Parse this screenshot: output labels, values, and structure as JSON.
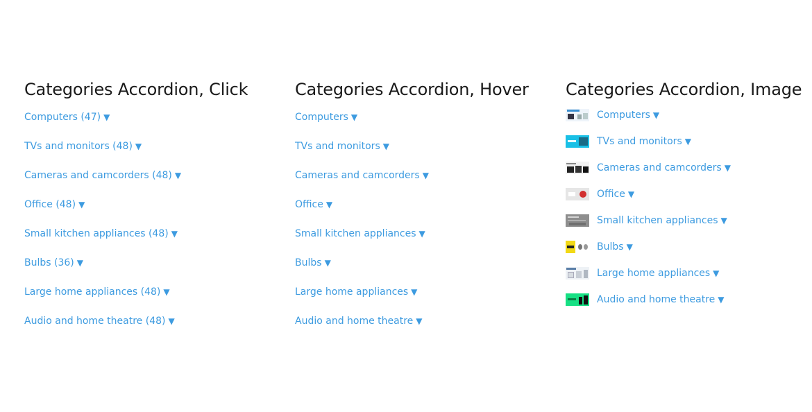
{
  "arrow_glyph": "▼",
  "accent_color": "#3d9be0",
  "click_accordion": {
    "title": "Categories Accordion, Click",
    "items": [
      {
        "label": "Computers (47)"
      },
      {
        "label": "TVs and monitors (48)"
      },
      {
        "label": "Cameras and camcorders (48)"
      },
      {
        "label": "Office (48)"
      },
      {
        "label": "Small kitchen appliances (48)"
      },
      {
        "label": "Bulbs (36)"
      },
      {
        "label": "Large home appliances (48)"
      },
      {
        "label": "Audio and home theatre (48)"
      }
    ]
  },
  "hover_accordion": {
    "title": "Categories Accordion, Hover",
    "items": [
      {
        "label": "Computers"
      },
      {
        "label": "TVs and monitors"
      },
      {
        "label": "Cameras and camcorders"
      },
      {
        "label": "Office"
      },
      {
        "label": "Small kitchen appliances"
      },
      {
        "label": "Bulbs"
      },
      {
        "label": "Large home appliances"
      },
      {
        "label": "Audio and home theatre"
      }
    ]
  },
  "image_accordion": {
    "title": "Categories Accordion, Image",
    "items": [
      {
        "label": "Computers",
        "thumb": "computers-thumbnail"
      },
      {
        "label": "TVs and monitors",
        "thumb": "tvs-thumbnail"
      },
      {
        "label": "Cameras and camcorders",
        "thumb": "cameras-thumbnail"
      },
      {
        "label": "Office",
        "thumb": "office-thumbnail"
      },
      {
        "label": "Small kitchen appliances",
        "thumb": "kitchen-thumbnail"
      },
      {
        "label": "Bulbs",
        "thumb": "bulbs-thumbnail"
      },
      {
        "label": "Large home appliances",
        "thumb": "large-appliances-thumbnail"
      },
      {
        "label": "Audio and home theatre",
        "thumb": "audio-thumbnail"
      }
    ]
  }
}
